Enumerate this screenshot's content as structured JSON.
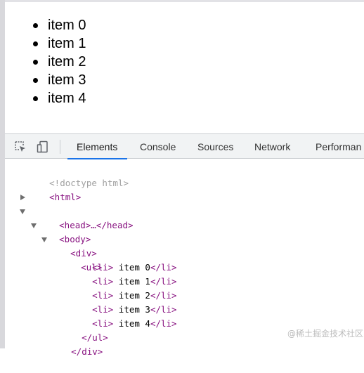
{
  "page": {
    "items": [
      "item 0",
      "item 1",
      "item 2",
      "item 3",
      "item 4"
    ]
  },
  "devtools": {
    "tabs": [
      {
        "label": "Elements",
        "active": true
      },
      {
        "label": "Console",
        "active": false
      },
      {
        "label": "Sources",
        "active": false
      },
      {
        "label": "Network",
        "active": false
      },
      {
        "label": "Performan",
        "active": false
      }
    ],
    "icons": [
      "inspect-element-icon",
      "device-toolbar-icon"
    ],
    "dom_lines": {
      "doctype": "<!doctype html>",
      "html_open": "<html>",
      "head_collapsed": "<head>…</head>",
      "body_open": "<body>",
      "div_open": "<div>",
      "ul_open": "<ul>",
      "li_lines": [
        {
          "open": "<li>",
          "text": " item 0",
          "close": "</li>"
        },
        {
          "open": "<li>",
          "text": " item 1",
          "close": "</li>"
        },
        {
          "open": "<li>",
          "text": " item 2",
          "close": "</li>"
        },
        {
          "open": "<li>",
          "text": " item 3",
          "close": "</li>"
        },
        {
          "open": "<li>",
          "text": " item 4",
          "close": "</li>"
        }
      ],
      "ul_close": "</ul>",
      "div_close": "</div>"
    },
    "watermark": "@稀土掘金技术社区"
  },
  "colors": {
    "tag": "#881280",
    "doctype": "#a0a0a0",
    "active_tab_underline": "#1a73e8",
    "toolbar_bg": "#f1f3f4"
  }
}
